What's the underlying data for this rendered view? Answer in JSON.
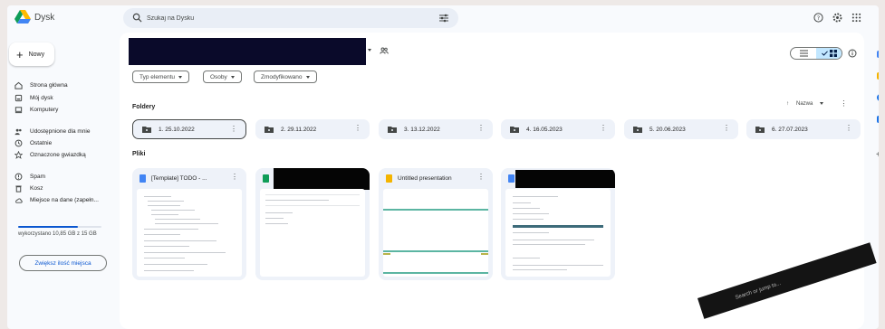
{
  "app": {
    "title": "Dysk"
  },
  "search": {
    "placeholder": "Szukaj na Dysku"
  },
  "sidebar": {
    "new_label": "Nowy",
    "items": [
      {
        "label": "Strona główna",
        "icon": "home-icon"
      },
      {
        "label": "Mój dysk",
        "icon": "drive-icon"
      },
      {
        "label": "Komputery",
        "icon": "computer-icon"
      },
      {
        "label": "Udostępnione dla mnie",
        "icon": "people-icon"
      },
      {
        "label": "Ostatnie",
        "icon": "clock-icon"
      },
      {
        "label": "Oznaczone gwiazdką",
        "icon": "star-icon"
      },
      {
        "label": "Spam",
        "icon": "spam-icon"
      },
      {
        "label": "Kosz",
        "icon": "trash-icon"
      },
      {
        "label": "Miejsce na dane (zapełn...",
        "icon": "cloud-icon"
      }
    ],
    "storage_used_text": "wykorzystano 10,85 GB z 15 GB",
    "storage_fraction": 0.72,
    "upgrade_label": "Zwiększ ilość miejsca"
  },
  "filters": [
    "Typ elementu",
    "Osoby",
    "Zmodyfikowano"
  ],
  "sections": {
    "folders": "Foldery",
    "files": "Pliki"
  },
  "sort": {
    "label": "Nazwa"
  },
  "folders": [
    {
      "name": "1. 25.10.2022"
    },
    {
      "name": "2. 29.11.2022"
    },
    {
      "name": "3. 13.12.2022"
    },
    {
      "name": "4. 16.05.2023"
    },
    {
      "name": "5. 20.06.2023"
    },
    {
      "name": "6. 27.07.2023"
    }
  ],
  "files": [
    {
      "name": "[Template] TODO - ...",
      "type": "doc",
      "color": "#4285f4"
    },
    {
      "name": "",
      "type": "sheet",
      "color": "#0f9d58"
    },
    {
      "name": "Untitled presentation",
      "type": "slides",
      "color": "#f4b400"
    },
    {
      "name": "",
      "type": "doc",
      "color": "#4285f4"
    }
  ],
  "overlay": {
    "text": "Search or jump to..."
  },
  "colors": {
    "accent": "#0b57d0",
    "selected": "#c2e7ff"
  }
}
